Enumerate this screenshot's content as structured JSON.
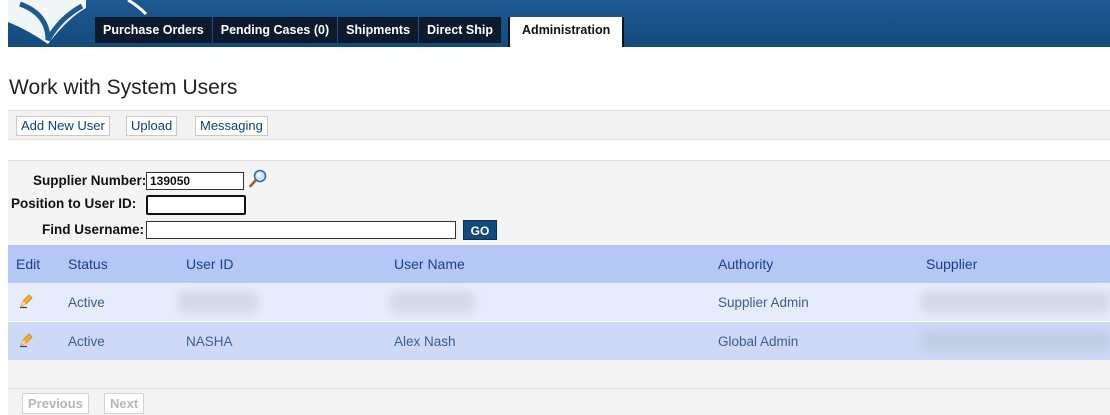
{
  "nav": {
    "tabs": [
      {
        "label": "Purchase Orders"
      },
      {
        "label": "Pending Cases (0)"
      },
      {
        "label": "Shipments"
      },
      {
        "label": "Direct Ship"
      },
      {
        "label": "Administration",
        "active": true
      }
    ]
  },
  "page": {
    "title": "Work with System Users"
  },
  "toolbar": {
    "add_label": "Add New User",
    "upload_label": "Upload",
    "messaging_label": "Messaging"
  },
  "filters": {
    "supplier_label": "Supplier Number:",
    "supplier_value": "139050",
    "position_label": "Position to User ID:",
    "position_value": "",
    "find_label": "Find Username:",
    "find_value": "",
    "go_label": "GO"
  },
  "table": {
    "headers": {
      "edit": "Edit",
      "status": "Status",
      "user_id": "User ID",
      "user_name": "User Name",
      "authority": "Authority",
      "supplier": "Supplier"
    },
    "rows": [
      {
        "status": "Active",
        "user_id": "",
        "user_name": "",
        "authority": "Supplier Admin",
        "supplier": "",
        "redacted": true
      },
      {
        "status": "Active",
        "user_id": "NASHA",
        "user_name": "Alex Nash",
        "authority": "Global Admin",
        "supplier": "",
        "redacted_supplier": true
      }
    ]
  },
  "pager": {
    "previous_label": "Previous",
    "next_label": "Next"
  },
  "colors": {
    "nav_blue": "#134a7c",
    "table_header": "#b4c7f5",
    "row_light": "#e6ecfb",
    "row_dark": "#cdd9f7",
    "link_text": "#3a5f8e"
  },
  "icons": {
    "search": "magnifier-icon",
    "edit": "pencil-icon",
    "logo": "brand-logo"
  }
}
